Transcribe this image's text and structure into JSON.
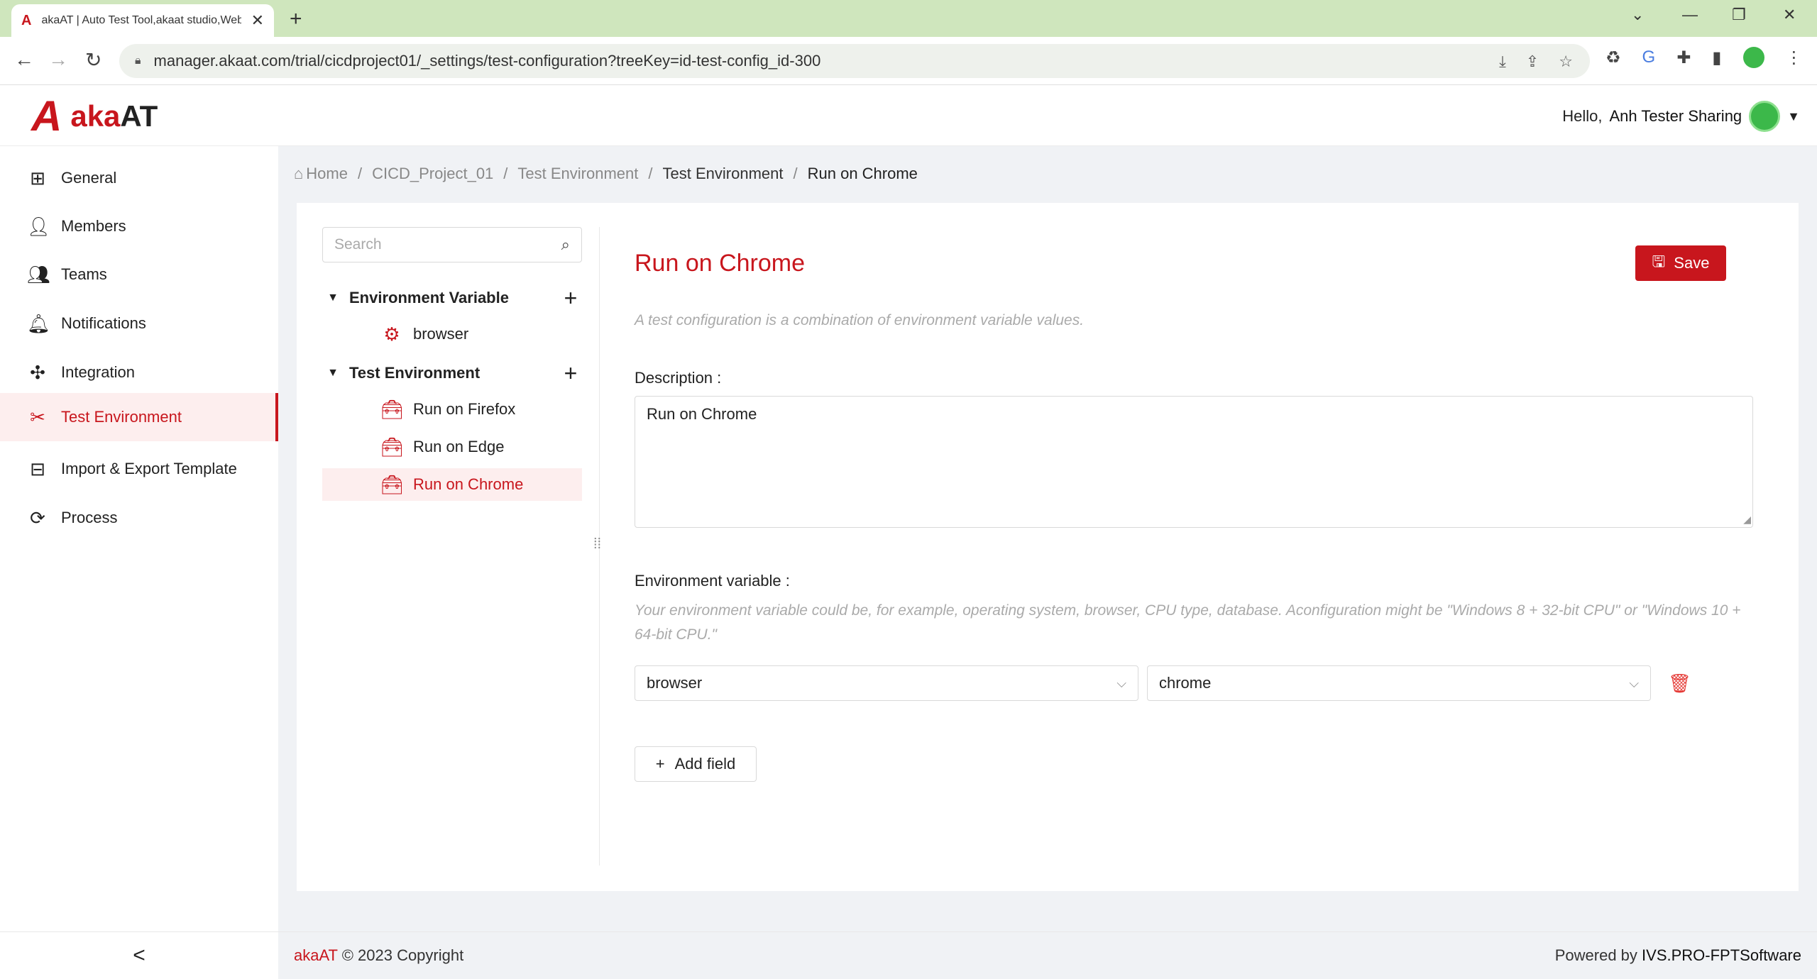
{
  "browser": {
    "tab_title": "akaAT | Auto Test Tool,akaat studio,Web",
    "tab_close": "✕",
    "new_tab": "+",
    "url": "manager.akaat.com/trial/cicdproject01/_settings/test-configuration?treeKey=id-test-config_id-300"
  },
  "header": {
    "logo_mark": "A",
    "logo_red": "aka",
    "logo_dark": "AT",
    "greeting": "Hello,",
    "user_name": "Anh Tester Sharing"
  },
  "sidebar": {
    "items": [
      {
        "label": "General",
        "icon": "grid-icon"
      },
      {
        "label": "Members",
        "icon": "members-icon"
      },
      {
        "label": "Teams",
        "icon": "teams-icon"
      },
      {
        "label": "Notifications",
        "icon": "bell-icon"
      },
      {
        "label": "Integration",
        "icon": "integration-icon"
      },
      {
        "label": "Test Environment",
        "icon": "tools-icon",
        "active": true
      },
      {
        "label": "Import & Export Template",
        "icon": "template-icon"
      },
      {
        "label": "Process",
        "icon": "process-icon"
      }
    ],
    "collapse": "<"
  },
  "breadcrumb": {
    "home": "Home",
    "project": "CICD_Project_01",
    "section": "Test Environment",
    "subsection": "Test Environment",
    "current": "Run on Chrome"
  },
  "tree": {
    "search_placeholder": "Search",
    "groups": [
      {
        "label": "Environment Variable",
        "children": [
          "browser"
        ]
      },
      {
        "label": "Test Environment",
        "children": [
          "Run on Firefox",
          "Run on Edge",
          "Run on Chrome"
        ]
      }
    ],
    "selected": "Run on Chrome"
  },
  "form": {
    "title": "Run on Chrome",
    "save_label": "Save",
    "hint": "A test configuration is a combination of environment variable values.",
    "description_label": "Description",
    "description_value": "Run on Chrome",
    "env_label": "Environment variable",
    "env_hint": "Your environment variable could be, for example, operating system, browser, CPU type, database. Aconfiguration might be \"Windows 8 + 32-bit CPU\" or \"Windows 10 + 64-bit CPU.\"",
    "variable_select": "browser",
    "value_select": "chrome",
    "add_field_label": "Add field"
  },
  "footer": {
    "brand": "akaAT",
    "copyright": "© 2023 Copyright",
    "powered_by": "Powered by",
    "powered_org": "IVS.PRO-FPTSoftware"
  },
  "colors": {
    "accent": "#c8161d",
    "active_bg": "#fdeeee",
    "tabbar": "#cfe6bd"
  }
}
